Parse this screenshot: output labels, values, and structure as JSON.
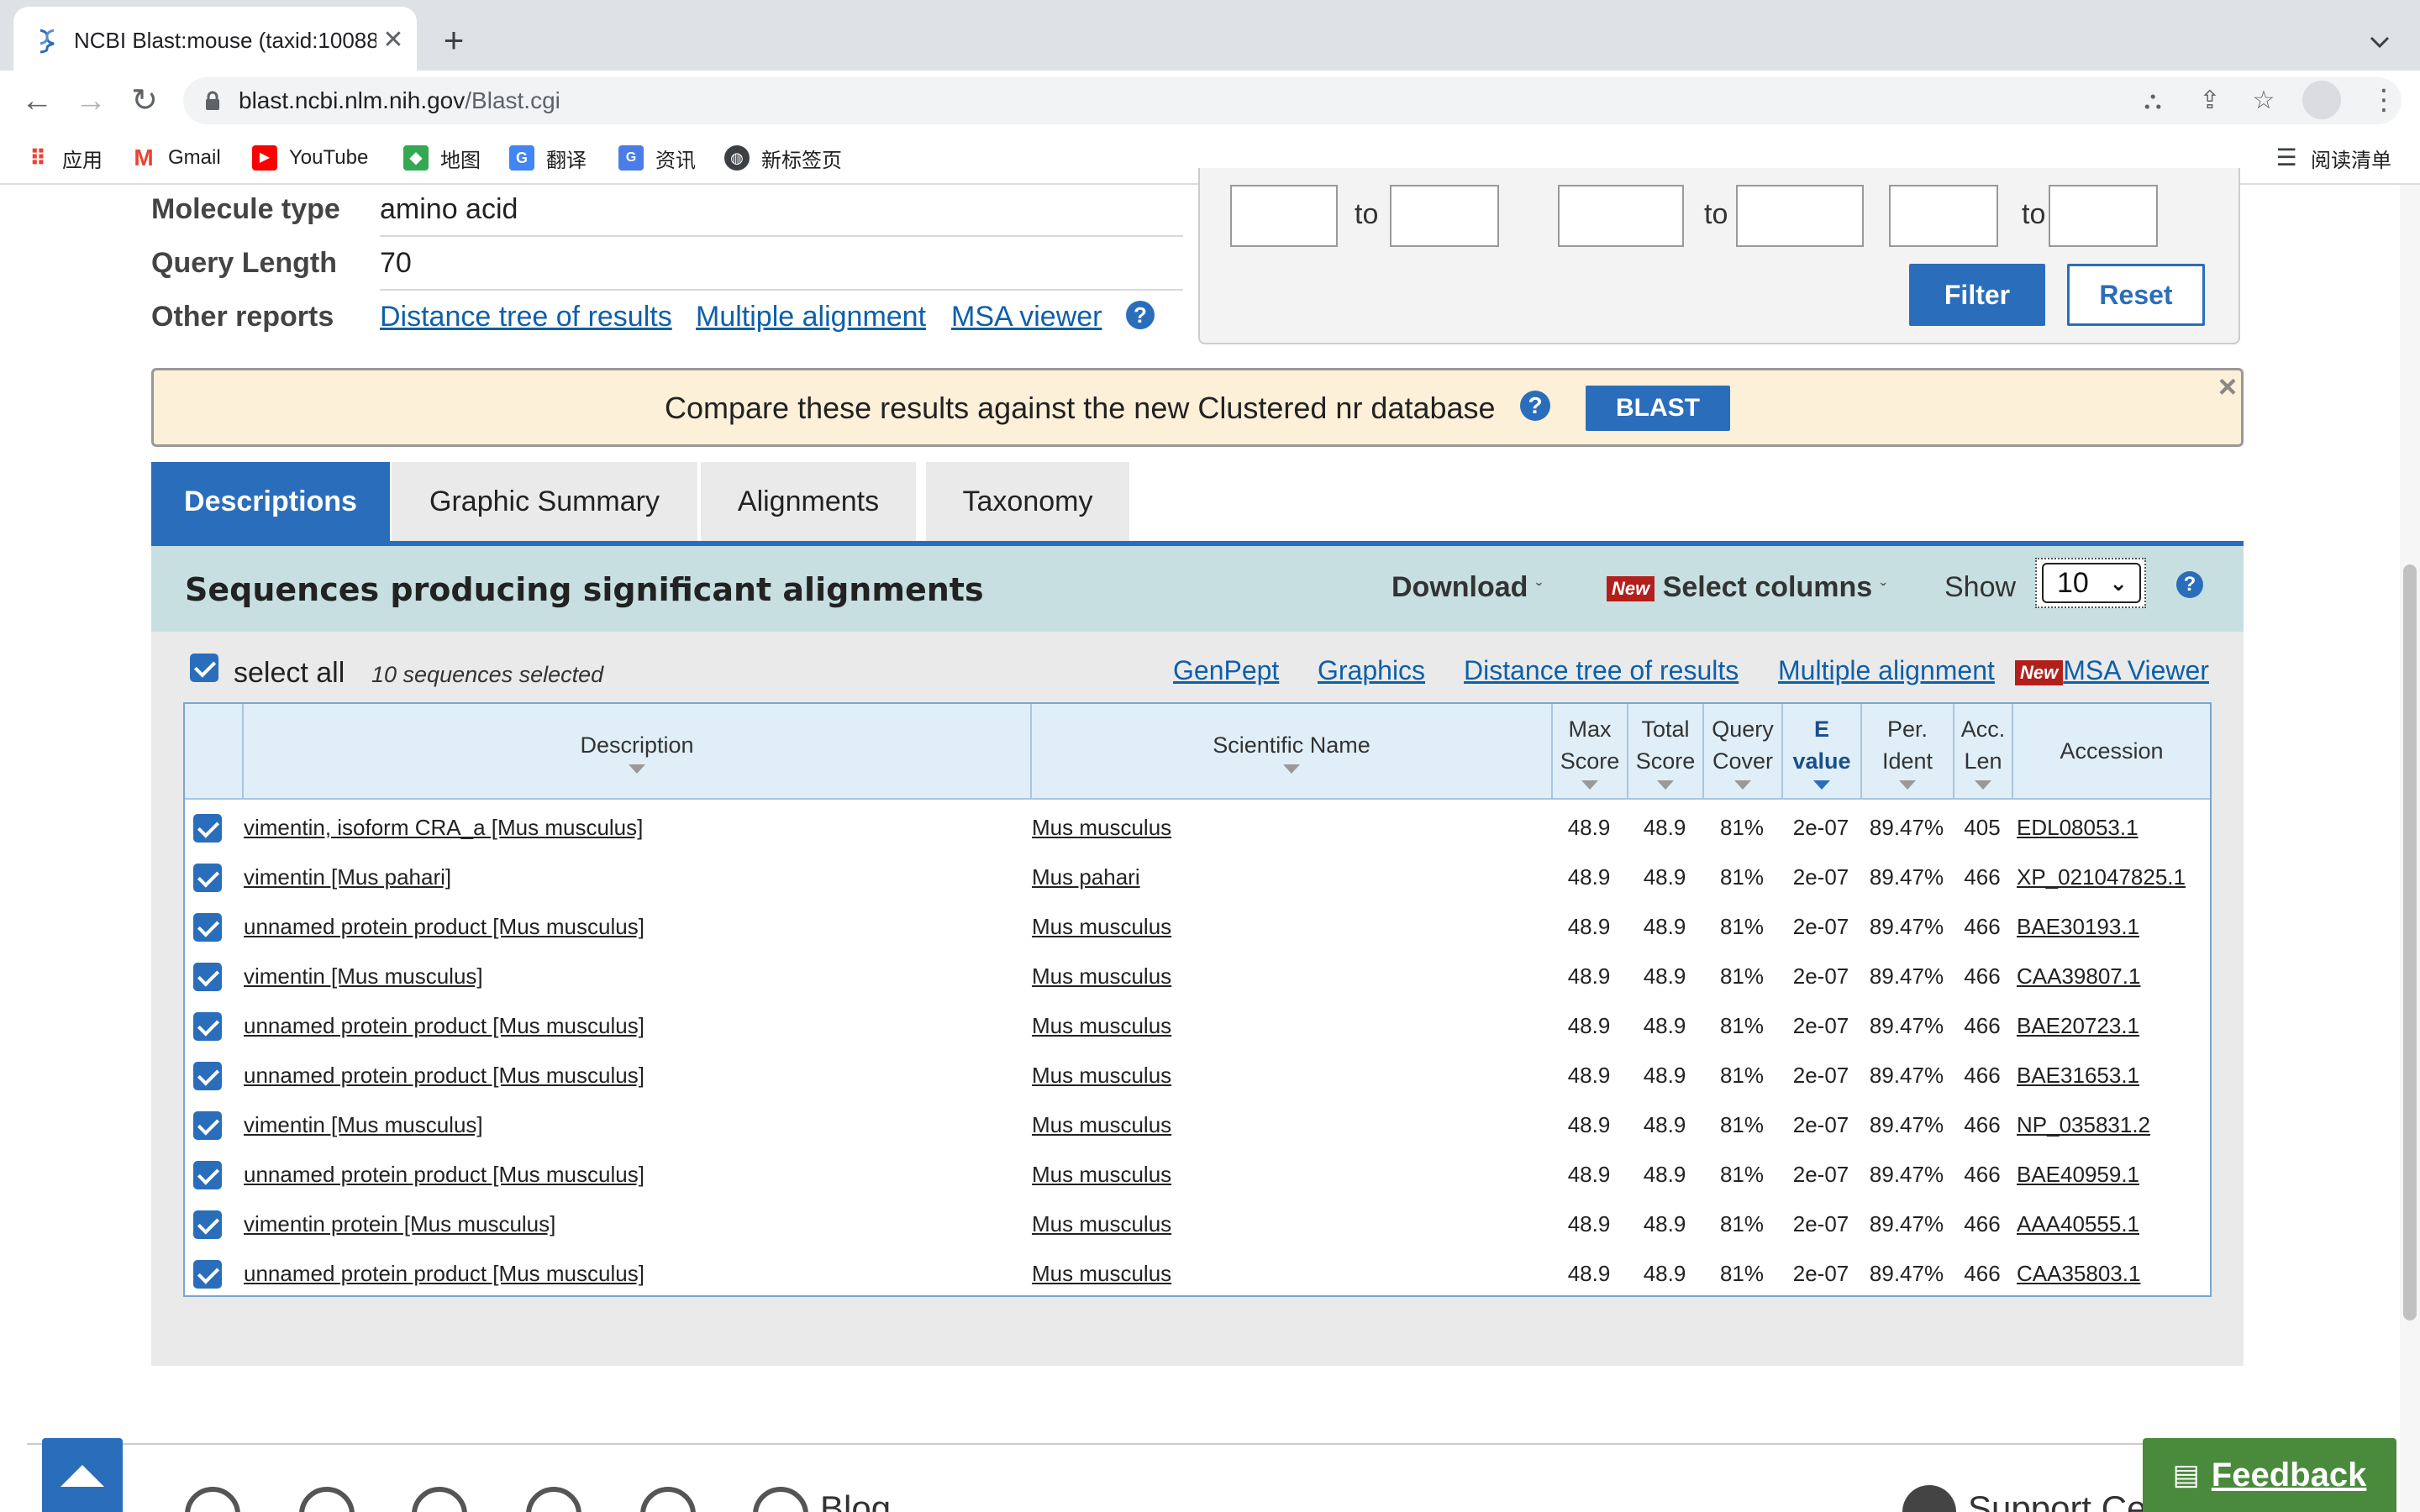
{
  "browser": {
    "tab_title": "NCBI Blast:mouse (taxid:10088",
    "url_host": "blast.ncbi.nlm.nih.gov",
    "url_path": "/Blast.cgi",
    "bookmarks": [
      {
        "label": "应用",
        "icon": "apps-grid-icon"
      },
      {
        "label": "Gmail",
        "icon": "gmail-icon"
      },
      {
        "label": "YouTube",
        "icon": "youtube-icon"
      },
      {
        "label": "地图",
        "icon": "maps-icon"
      },
      {
        "label": "翻译",
        "icon": "translate-icon"
      },
      {
        "label": "资讯",
        "icon": "news-icon"
      },
      {
        "label": "新标签页",
        "icon": "globe-icon"
      }
    ],
    "reading_list": "阅读清单"
  },
  "summary": {
    "molecule_type_label": "Molecule type",
    "molecule_type_value": "amino acid",
    "query_length_label": "Query Length",
    "query_length_value": "70",
    "other_reports_label": "Other reports",
    "links": [
      "Distance tree of results",
      "Multiple alignment",
      "MSA viewer"
    ]
  },
  "filter": {
    "to_label": "to",
    "filter_button": "Filter",
    "reset_button": "Reset"
  },
  "banner": {
    "text": "Compare these results against the new Clustered nr database",
    "button": "BLAST"
  },
  "tabs": [
    "Descriptions",
    "Graphic Summary",
    "Alignments",
    "Taxonomy"
  ],
  "results_header": {
    "title": "Sequences producing significant alignments",
    "download": "Download",
    "new_tag": "New",
    "select_columns": "Select columns",
    "show_label": "Show",
    "show_value": "10"
  },
  "selection": {
    "select_all": "select all",
    "count_text": "10 sequences selected",
    "links": [
      "GenPept",
      "Graphics",
      "Distance tree of results",
      "Multiple alignment"
    ],
    "msa_new": "New",
    "msa_link": "MSA Viewer"
  },
  "table": {
    "headers": {
      "description": "Description",
      "scientific_name": "Scientific Name",
      "max_score": [
        "Max",
        "Score"
      ],
      "total_score": [
        "Total",
        "Score"
      ],
      "query_cover": [
        "Query",
        "Cover"
      ],
      "e_value": [
        "E",
        "value"
      ],
      "per_ident": [
        "Per.",
        "Ident"
      ],
      "acc_len": [
        "Acc.",
        "Len"
      ],
      "accession": "Accession"
    },
    "rows": [
      {
        "description": "vimentin, isoform CRA_a [Mus musculus]",
        "scientific_name": "Mus musculus",
        "max_score": "48.9",
        "total_score": "48.9",
        "query_cover": "81%",
        "e_value": "2e-07",
        "per_ident": "89.47%",
        "acc_len": "405",
        "accession": "EDL08053.1"
      },
      {
        "description": "vimentin [Mus pahari]",
        "scientific_name": "Mus pahari",
        "max_score": "48.9",
        "total_score": "48.9",
        "query_cover": "81%",
        "e_value": "2e-07",
        "per_ident": "89.47%",
        "acc_len": "466",
        "accession": "XP_021047825.1"
      },
      {
        "description": "unnamed protein product [Mus musculus]",
        "scientific_name": "Mus musculus",
        "max_score": "48.9",
        "total_score": "48.9",
        "query_cover": "81%",
        "e_value": "2e-07",
        "per_ident": "89.47%",
        "acc_len": "466",
        "accession": "BAE30193.1"
      },
      {
        "description": "vimentin [Mus musculus]",
        "scientific_name": "Mus musculus",
        "max_score": "48.9",
        "total_score": "48.9",
        "query_cover": "81%",
        "e_value": "2e-07",
        "per_ident": "89.47%",
        "acc_len": "466",
        "accession": "CAA39807.1"
      },
      {
        "description": "unnamed protein product [Mus musculus]",
        "scientific_name": "Mus musculus",
        "max_score": "48.9",
        "total_score": "48.9",
        "query_cover": "81%",
        "e_value": "2e-07",
        "per_ident": "89.47%",
        "acc_len": "466",
        "accession": "BAE20723.1"
      },
      {
        "description": "unnamed protein product [Mus musculus]",
        "scientific_name": "Mus musculus",
        "max_score": "48.9",
        "total_score": "48.9",
        "query_cover": "81%",
        "e_value": "2e-07",
        "per_ident": "89.47%",
        "acc_len": "466",
        "accession": "BAE31653.1"
      },
      {
        "description": "vimentin [Mus musculus]",
        "scientific_name": "Mus musculus",
        "max_score": "48.9",
        "total_score": "48.9",
        "query_cover": "81%",
        "e_value": "2e-07",
        "per_ident": "89.47%",
        "acc_len": "466",
        "accession": "NP_035831.2"
      },
      {
        "description": "unnamed protein product [Mus musculus]",
        "scientific_name": "Mus musculus",
        "max_score": "48.9",
        "total_score": "48.9",
        "query_cover": "81%",
        "e_value": "2e-07",
        "per_ident": "89.47%",
        "acc_len": "466",
        "accession": "BAE40959.1"
      },
      {
        "description": "vimentin protein [Mus musculus]",
        "scientific_name": "Mus musculus",
        "max_score": "48.9",
        "total_score": "48.9",
        "query_cover": "81%",
        "e_value": "2e-07",
        "per_ident": "89.47%",
        "acc_len": "466",
        "accession": "AAA40555.1"
      },
      {
        "description": "unnamed protein product [Mus musculus]",
        "scientific_name": "Mus musculus",
        "max_score": "48.9",
        "total_score": "48.9",
        "query_cover": "81%",
        "e_value": "2e-07",
        "per_ident": "89.47%",
        "acc_len": "466",
        "accession": "CAA35803.1"
      }
    ]
  },
  "footer": {
    "blog": "Blog",
    "support": "Support Ce",
    "feedback": "Feedback"
  },
  "colors": {
    "accent": "#2a6ebb",
    "banner_bg": "#fcf0d8",
    "header_bg": "#c7dfe0",
    "new_tag": "#b3201c",
    "feedback_bg": "#4a8a3c"
  }
}
